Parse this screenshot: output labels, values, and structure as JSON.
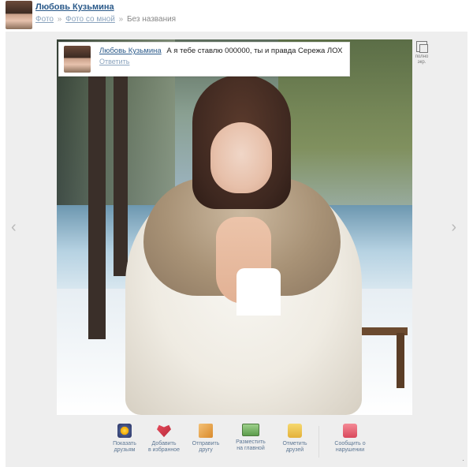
{
  "header": {
    "username": "Любовь Кузьмина",
    "breadcrumb": {
      "item1": "Фото",
      "sep1": "»",
      "item2": "Фото со мной",
      "sep2": "»",
      "current": "Без названия"
    }
  },
  "viewer": {
    "nav_prev": "‹",
    "nav_next": "›",
    "fullscreen_label_line1": "полно",
    "fullscreen_label_line2": "экр.",
    "comment": {
      "author": "Любовь Кузьмина",
      "text": "А я тебе ставлю 000000, ты и правда Сережа ЛОХ",
      "reply": "Ответить"
    },
    "actions": [
      {
        "line1": "Показать",
        "line2": "друзьям",
        "icon": "friends-show-icon"
      },
      {
        "line1": "Добавить",
        "line2": "в избранное",
        "icon": "heart-add-icon"
      },
      {
        "line1": "Отправить",
        "line2": "другу",
        "icon": "send-friend-icon"
      },
      {
        "line1": "Разместить",
        "line2": "на главной",
        "icon": "place-main-icon"
      },
      {
        "line1": "Отметить",
        "line2": "друзей",
        "icon": "tag-friends-icon"
      },
      {
        "line1": "Сообщить о",
        "line2": "нарушении",
        "icon": "report-icon"
      }
    ],
    "corner_mark": "·"
  },
  "colors": {
    "link": "#2b5a8a",
    "link_light": "#8aa3bd",
    "viewer_bg": "#eeeeee"
  }
}
